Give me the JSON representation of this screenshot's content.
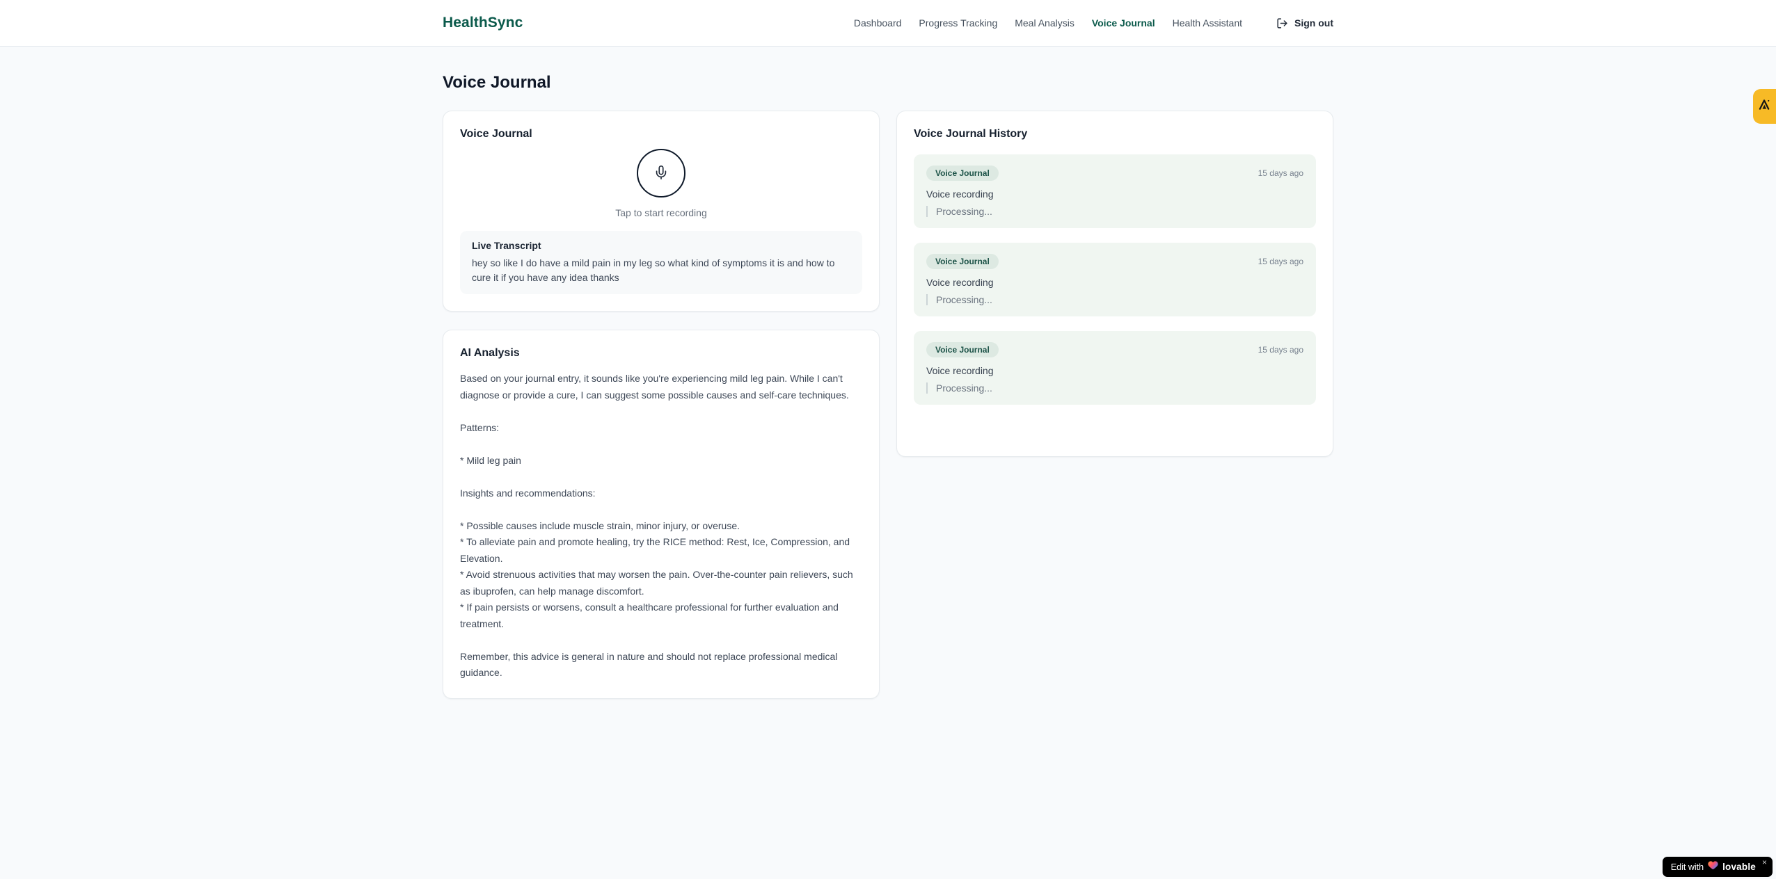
{
  "header": {
    "logo": "HealthSync",
    "nav": [
      {
        "label": "Dashboard",
        "active": false
      },
      {
        "label": "Progress Tracking",
        "active": false
      },
      {
        "label": "Meal Analysis",
        "active": false
      },
      {
        "label": "Voice Journal",
        "active": true
      },
      {
        "label": "Health Assistant",
        "active": false
      }
    ],
    "signout_label": "Sign out"
  },
  "page": {
    "title": "Voice Journal"
  },
  "recorder_card": {
    "title": "Voice Journal",
    "tap_hint": "Tap to start recording",
    "transcript_label": "Live Transcript",
    "transcript_text": "hey so like I do have a mild pain in my leg so what kind of symptoms it is and how to cure it if you have any idea thanks"
  },
  "analysis_card": {
    "title": "AI Analysis",
    "body": "Based on your journal entry, it sounds like you're experiencing mild leg pain. While I can't diagnose or provide a cure, I can suggest some possible causes and self-care techniques.\n\nPatterns:\n\n* Mild leg pain\n\nInsights and recommendations:\n\n* Possible causes include muscle strain, minor injury, or overuse.\n* To alleviate pain and promote healing, try the RICE method: Rest, Ice, Compression, and Elevation.\n* Avoid strenuous activities that may worsen the pain. Over-the-counter pain relievers, such as ibuprofen, can help manage discomfort.\n* If pain persists or worsens, consult a healthcare professional for further evaluation and treatment.\n\nRemember, this advice is general in nature and should not replace professional medical guidance."
  },
  "history_card": {
    "title": "Voice Journal History",
    "entries": [
      {
        "badge": "Voice Journal",
        "time": "15 days ago",
        "label": "Voice recording",
        "status": "Processing..."
      },
      {
        "badge": "Voice Journal",
        "time": "15 days ago",
        "label": "Voice recording",
        "status": "Processing..."
      },
      {
        "badge": "Voice Journal",
        "time": "15 days ago",
        "label": "Voice recording",
        "status": "Processing..."
      }
    ]
  },
  "floating": {
    "edit_badge": {
      "prefix": "Edit with",
      "brand": "lovable",
      "close": "×"
    }
  },
  "colors": {
    "brand": "#0b5a4b",
    "nav_inactive": "#46515e",
    "page_bg": "#f8fafc",
    "entry_bg": "#f0f6f1",
    "badge_bg": "#dde9e2",
    "badge_text": "#1d5348",
    "tab_yellow": "#f7ba26",
    "mic_border": "#0f1a2a"
  }
}
